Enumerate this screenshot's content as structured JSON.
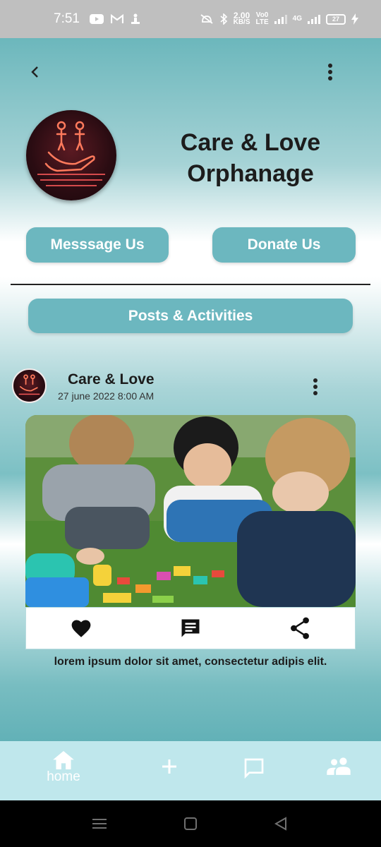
{
  "status_bar": {
    "time": "7:51",
    "net_speed_value": "2.00",
    "net_speed_unit": "KB/S",
    "volte_label_top": "Vo0",
    "volte_label_bottom": "LTE",
    "network_label": "4G",
    "battery": "27"
  },
  "header": {
    "back_icon": "chevron-left-icon",
    "more_icon": "more-vertical-icon"
  },
  "profile": {
    "title_line1": "Care & Love",
    "title_line2": "Orphanage",
    "message_button": "Messsage Us",
    "donate_button": "Donate Us"
  },
  "posts_section": {
    "button_label": "Posts & Activities"
  },
  "post": {
    "author": "Care & Love",
    "date": "27 june 2022  8:00 AM",
    "caption": "lorem ipsum dolor sit amet, consectetur adipis elit.",
    "actions": [
      "heart-icon",
      "comment-icon",
      "share-icon"
    ]
  },
  "bottom_nav": {
    "home_label": "home",
    "items": [
      "home-icon",
      "add-icon",
      "chat-icon",
      "people-icon"
    ]
  },
  "colors": {
    "accent": "#6cb7bf",
    "nav_background": "#bfe7ec",
    "status_bar": "#bfbfbf"
  }
}
